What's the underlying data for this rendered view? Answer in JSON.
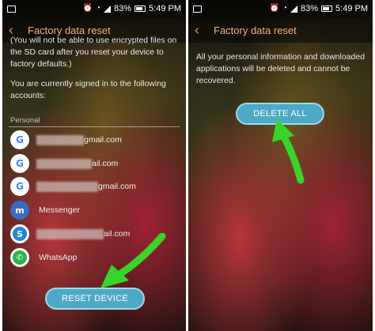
{
  "left": {
    "status": {
      "battery": "83%",
      "time": "5:49 PM"
    },
    "title": "Factory data reset",
    "intro": "(You will not be able to use encrypted files on the SD card after you reset your device to factory defaults.)",
    "signed_in": "You are currently signed in to the following accounts:",
    "section": "Personal",
    "accounts": [
      {
        "icon": "G",
        "text": "gmail.com"
      },
      {
        "icon": "G",
        "text": "ail.com"
      },
      {
        "icon": "G",
        "text": "gmail.com"
      },
      {
        "icon": "m",
        "text": "Messenger"
      },
      {
        "icon": "S",
        "text": "ail.com"
      },
      {
        "icon": "✆",
        "text": "WhatsApp"
      }
    ],
    "button": "RESET DEVICE"
  },
  "right": {
    "status": {
      "battery": "83%",
      "time": "5:49 PM"
    },
    "title": "Factory data reset",
    "message": "All your personal information and downloaded applications will be deleted and cannot be recovered.",
    "button": "DELETE ALL"
  },
  "colors": {
    "accent": "#f08a3c",
    "button": "#4fa9c6",
    "arrow": "#39d42a"
  }
}
